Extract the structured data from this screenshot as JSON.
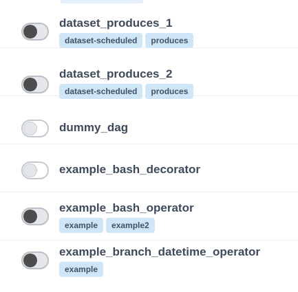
{
  "dags": [
    {
      "name": "dataset_produces_1",
      "tags": [
        "dataset-scheduled",
        "produces"
      ]
    },
    {
      "name": "dataset_produces_2",
      "tags": [
        "dataset-scheduled",
        "produces"
      ]
    },
    {
      "name": "dummy_dag",
      "tags": []
    },
    {
      "name": "example_bash_decorator",
      "tags": []
    },
    {
      "name": "example_bash_operator",
      "tags": [
        "example",
        "example2"
      ]
    },
    {
      "name": "example_branch_datetime_operator",
      "tags": [
        "example"
      ]
    }
  ],
  "colors": {
    "tag_background": "#cfe6f6",
    "toggle_knob_active": "#4d4d4d"
  }
}
